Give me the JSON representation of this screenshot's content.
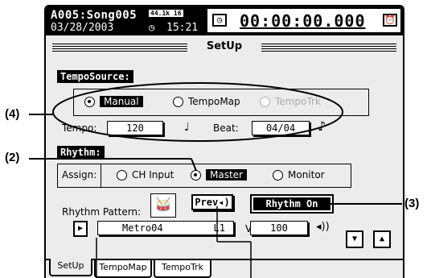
{
  "status": {
    "song": "A005:Song005",
    "date": "03/28/2003",
    "meter": "44.1k 16",
    "clock_icon": "clock-icon",
    "clock": "15:21",
    "counter": "00:00:00.000"
  },
  "title": "SetUp",
  "tempo_source": {
    "label": "TempoSource:",
    "options": [
      "Manual",
      "TempoMap",
      "TempoTrk"
    ],
    "selected": "Manual",
    "tempo_label": "Tempo:",
    "tempo_value": "120",
    "note_glyph": "♩",
    "beat_label": "Beat:",
    "beat_value": "04/04"
  },
  "rhythm": {
    "label": "Rhythm:",
    "assign_label": "Assign:",
    "options": [
      "CH Input",
      "Master",
      "Monitor"
    ],
    "selected": "Master",
    "pattern_label": "Rhythm Pattern:",
    "prev_label": "Prev",
    "rhythm_on_label": "Rhythm On",
    "pattern_value": "Metro04",
    "pattern_slot": "L1",
    "vol_label": "Vol:",
    "vol_value": "100"
  },
  "tabs": [
    "SetUp",
    "TempoMap",
    "TempoTrk"
  ],
  "callouts": [
    "(4)",
    "(2)",
    "(3)"
  ],
  "colors": {
    "ink": "#000000",
    "panel": "#ececec",
    "paper": "#ffffff"
  }
}
